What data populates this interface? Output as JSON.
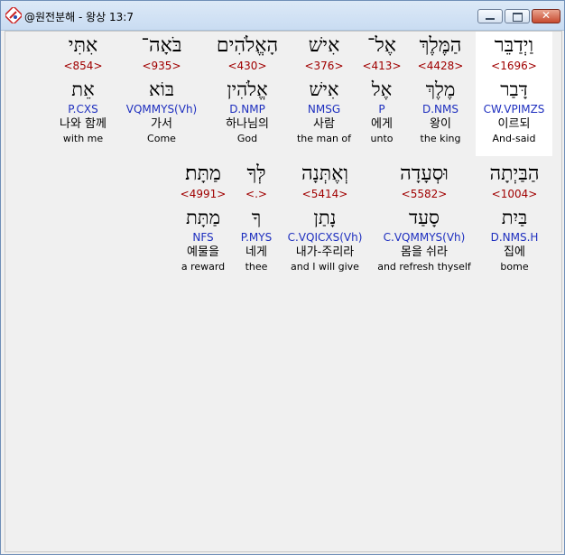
{
  "window": {
    "title": "@원전분해 - 왕상 13:7",
    "icon": "app-logo-icon"
  },
  "buttons": {
    "close": "✕"
  },
  "rows": [
    [
      {
        "heb": "וַיְדַבֵּר",
        "strong": "<1696>",
        "lemma": "דָּבַר",
        "morph": "CW.VPIMZS",
        "kor": "이르되",
        "eng": "And-said",
        "highlight": true
      },
      {
        "heb": "הַמֶּלֶךְ",
        "strong": "<4428>",
        "lemma": "מֶלֶךְ",
        "morph": "D.NMS",
        "kor": "왕이",
        "eng": "the king"
      },
      {
        "heb": "אֶל־",
        "strong": "<413>",
        "lemma": "אֶל",
        "morph": "P",
        "kor": "에게",
        "eng": "unto"
      },
      {
        "heb": "אִישׁ",
        "strong": "<376>",
        "lemma": "אִישׁ",
        "morph": "NMSG",
        "kor": "사람",
        "eng": "the man of"
      },
      {
        "heb": "הָאֱלֹהִים",
        "strong": "<430>",
        "lemma": "אֱלֹהִין",
        "morph": "D.NMP",
        "kor": "하나님의",
        "eng": "God"
      },
      {
        "heb": "בֹּאָה־",
        "strong": "<935>",
        "lemma": "בּוֹא",
        "morph": "VQMMYS(Vh)",
        "kor": "가서",
        "eng": "Come"
      },
      {
        "heb": "אִתִּי",
        "strong": "<854>",
        "lemma": "אֵת",
        "morph": "P.CXS",
        "kor": "나와 함께",
        "eng": "with me"
      }
    ],
    [
      {
        "heb": "הַבַּיְתָה",
        "strong": "<1004>",
        "lemma": "בַּיִת",
        "morph": "D.NMS.H",
        "kor": "집에",
        "eng": "bome"
      },
      {
        "heb": "וּסְעָדָה",
        "strong": "<5582>",
        "lemma": "סָעַד",
        "morph": "C.VQMMYS(Vh)",
        "kor": "몸을 쉬라",
        "eng": "and refresh thyself"
      },
      {
        "heb": "וְאֶתְּנָה",
        "strong": "<5414>",
        "lemma": "נָתַן",
        "morph": "C.VQICXS(Vh)",
        "kor": "내가-주리라",
        "eng": "and I will give"
      },
      {
        "heb": "לְּךָ",
        "strong": "<.>",
        "lemma": "ךָ",
        "morph": "P.MYS",
        "kor": "네게",
        "eng": "thee"
      },
      {
        "heb": "מַתָּת׃",
        "strong": "<4991>",
        "lemma": "מַתָּת",
        "morph": "NFS",
        "kor": "예물을",
        "eng": "a reward"
      }
    ]
  ]
}
